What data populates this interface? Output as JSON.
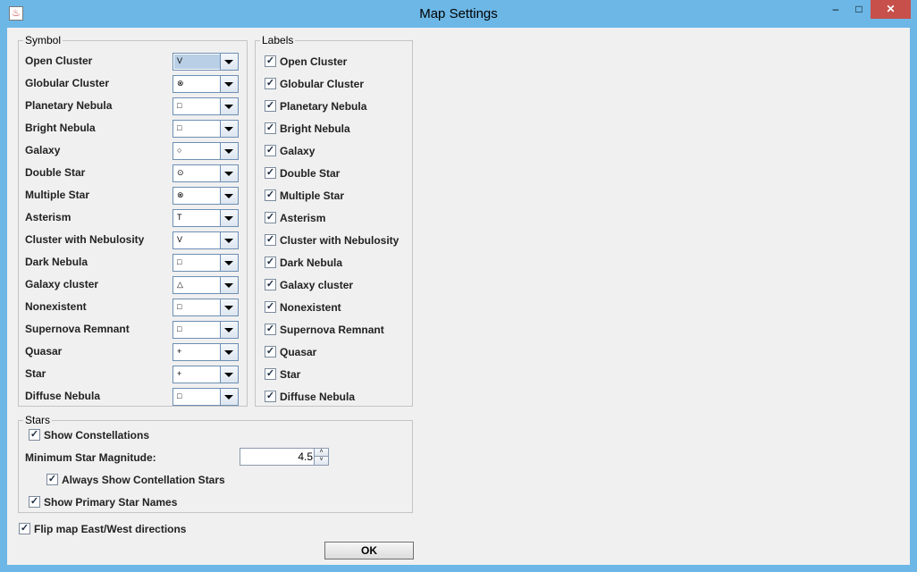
{
  "window": {
    "title": "Map Settings",
    "minimize": "–",
    "maximize": "□",
    "close": "✕"
  },
  "symbol_group": {
    "legend": "Symbol",
    "rows": [
      {
        "label": "Open Cluster",
        "symbol": "V"
      },
      {
        "label": "Globular Cluster",
        "symbol": "⊗"
      },
      {
        "label": "Planetary Nebula",
        "symbol": "□"
      },
      {
        "label": "Bright Nebula",
        "symbol": "□"
      },
      {
        "label": "Galaxy",
        "symbol": "○"
      },
      {
        "label": "Double Star",
        "symbol": "⊙"
      },
      {
        "label": "Multiple Star",
        "symbol": "⊗"
      },
      {
        "label": "Asterism",
        "symbol": "T"
      },
      {
        "label": "Cluster with Nebulosity",
        "symbol": "V"
      },
      {
        "label": "Dark Nebula",
        "symbol": "□"
      },
      {
        "label": "Galaxy cluster",
        "symbol": "△"
      },
      {
        "label": "Nonexistent",
        "symbol": "□"
      },
      {
        "label": "Supernova Remnant",
        "symbol": "□"
      },
      {
        "label": "Quasar",
        "symbol": "+"
      },
      {
        "label": "Star",
        "symbol": "+"
      },
      {
        "label": "Diffuse Nebula",
        "symbol": "□"
      }
    ]
  },
  "labels_group": {
    "legend": "Labels",
    "check_mark": "✓",
    "rows": [
      {
        "label": "Open Cluster"
      },
      {
        "label": "Globular Cluster"
      },
      {
        "label": "Planetary Nebula"
      },
      {
        "label": "Bright Nebula"
      },
      {
        "label": "Galaxy"
      },
      {
        "label": "Double Star"
      },
      {
        "label": "Multiple Star"
      },
      {
        "label": "Asterism"
      },
      {
        "label": "Cluster with Nebulosity"
      },
      {
        "label": "Dark Nebula"
      },
      {
        "label": "Galaxy cluster"
      },
      {
        "label": "Nonexistent"
      },
      {
        "label": "Supernova Remnant"
      },
      {
        "label": "Quasar"
      },
      {
        "label": "Star"
      },
      {
        "label": "Diffuse Nebula"
      }
    ]
  },
  "stars_group": {
    "legend": "Stars",
    "show_constellations": "Show Constellations",
    "min_magnitude_label": "Minimum Star Magnitude:",
    "min_magnitude_value": "4.5",
    "always_show": "Always Show Contellation Stars",
    "primary_names": "Show Primary Star Names"
  },
  "flip_label": "Flip map East/West directions",
  "ok_label": "OK",
  "spin_up": "˄",
  "spin_down": "˅",
  "app_icon_glyph": "♨"
}
